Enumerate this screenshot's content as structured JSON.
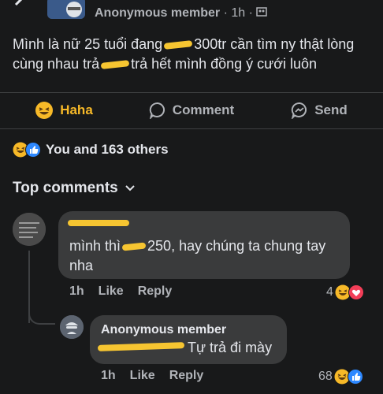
{
  "post": {
    "author": "Anonymous member",
    "time": "1h",
    "text_part1": "Mình là nữ 25 tuổi đang",
    "text_part2": "300tr cần tìm ny thật lòng cùng nhau trả",
    "text_part3": "trả hết mình đồng ý cưới luôn"
  },
  "actions": {
    "haha": "Haha",
    "comment": "Comment",
    "send": "Send"
  },
  "reactions": {
    "summary": "You and 163 others"
  },
  "comments_header": "Top comments",
  "comment1": {
    "text_part1": "mình thì",
    "text_part2": "250, hay chúng ta chung tay nha",
    "time": "1h",
    "like": "Like",
    "reply": "Reply",
    "count": "4"
  },
  "comment2": {
    "author": "Anonymous member",
    "text": "Tự trả đi mày",
    "time": "1h",
    "like": "Like",
    "reply": "Reply",
    "count": "68"
  },
  "colors": {
    "background": "#18191a",
    "bubble": "#3a3b3c",
    "haha": "#f7b928",
    "redaction": "#f6c531"
  }
}
